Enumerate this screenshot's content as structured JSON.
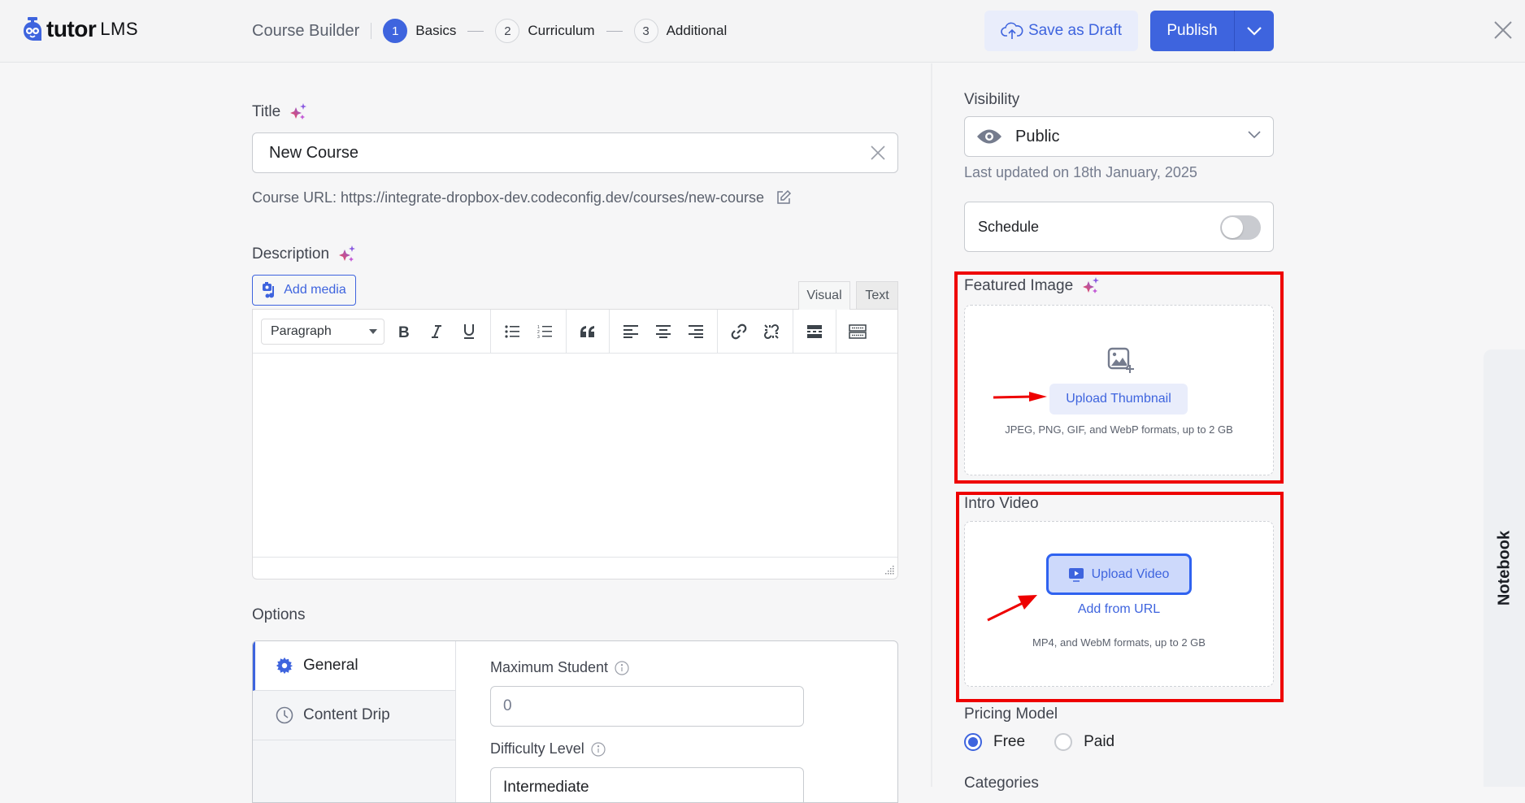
{
  "brand": {
    "name_bold": "tutor",
    "name_light": "LMS",
    "color": "#3e64de"
  },
  "header": {
    "builder_title": "Course Builder",
    "steps": [
      {
        "number": "1",
        "label": "Basics",
        "active": true
      },
      {
        "number": "2",
        "label": "Curriculum",
        "active": false
      },
      {
        "number": "3",
        "label": "Additional",
        "active": false
      }
    ],
    "save_draft_label": "Save as Draft",
    "publish_label": "Publish"
  },
  "main": {
    "title_label": "Title",
    "title_value": "New Course",
    "course_url_label": "Course URL:",
    "course_url_value": "https://integrate-dropbox-dev.codeconfig.dev/courses/new-course",
    "description_label": "Description",
    "add_media_label": "Add media",
    "editor_tabs": {
      "visual": "Visual",
      "text": "Text"
    },
    "format_select_value": "Paragraph",
    "toolbar_icons": [
      "bold-icon",
      "italic-icon",
      "underline-icon",
      "bullet-list-icon",
      "numbered-list-icon",
      "blockquote-icon",
      "align-left-icon",
      "align-center-icon",
      "align-right-icon",
      "link-icon",
      "unlink-icon",
      "read-more-icon",
      "toolbar-toggle-icon"
    ],
    "options_title": "Options",
    "options_tabs": [
      {
        "label": "General",
        "active": true
      },
      {
        "label": "Content Drip",
        "active": false
      }
    ],
    "max_student_label": "Maximum Student",
    "max_student_value": "0",
    "difficulty_label": "Difficulty Level",
    "difficulty_value": "Intermediate"
  },
  "sidebar": {
    "visibility_label": "Visibility",
    "visibility_value": "Public",
    "last_updated": "Last updated on 18th January, 2025",
    "schedule_label": "Schedule",
    "schedule_enabled": false,
    "featured_image_label": "Featured Image",
    "upload_thumbnail_label": "Upload Thumbnail",
    "image_formats": "JPEG, PNG, GIF, and WebP formats, up to 2 GB",
    "intro_video_label": "Intro Video",
    "upload_video_label": "Upload Video",
    "add_from_url_label": "Add from URL",
    "video_formats": "MP4, and WebM formats, up to 2 GB",
    "pricing_label": "Pricing Model",
    "pricing_options": [
      {
        "label": "Free",
        "checked": true
      },
      {
        "label": "Paid",
        "checked": false
      }
    ],
    "categories_label": "Categories"
  },
  "notebook": {
    "label": "Notebook"
  },
  "annotations": {
    "highlight_color": "#ee0000"
  }
}
